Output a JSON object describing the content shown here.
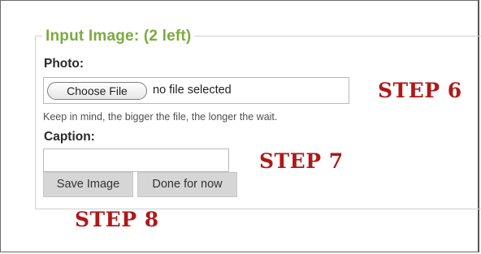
{
  "fieldset": {
    "legend": "Input Image: (2 left)"
  },
  "photo": {
    "label": "Photo:",
    "choose_button": "Choose File",
    "status": "no file selected",
    "hint": "Keep in mind, the bigger the file, the longer the wait."
  },
  "caption": {
    "label": "Caption:",
    "value": ""
  },
  "buttons": {
    "save": "Save Image",
    "done": "Done for now"
  },
  "annotations": {
    "step6": "STEP 6",
    "step7": "STEP 7",
    "step8": "STEP 8"
  },
  "colors": {
    "legend": "#7bab3e",
    "step_text": "#b01818"
  }
}
